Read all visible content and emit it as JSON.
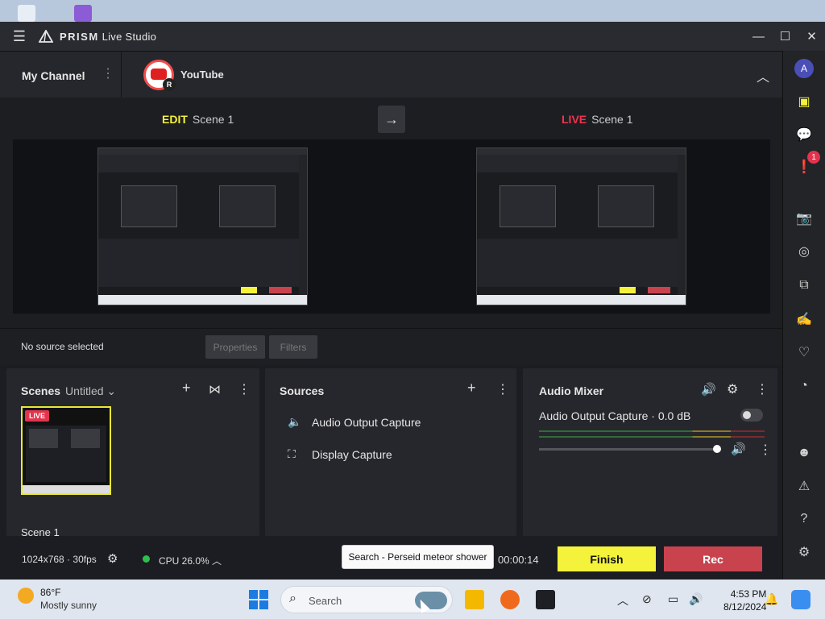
{
  "app": {
    "title_bold": "PRISM",
    "title_rest": "Live Studio",
    "window_buttons": {
      "minimize": "—",
      "maximize": "☐",
      "close": "✕"
    }
  },
  "channel": {
    "my_channel": "My Channel",
    "platform": "YouTube",
    "platform_badge": "R"
  },
  "preview": {
    "edit_keyword": "EDIT",
    "edit_scene": "Scene 1",
    "live_keyword": "LIVE",
    "live_scene": "Scene 1"
  },
  "properties_bar": {
    "status": "No source selected",
    "properties_label": "Properties",
    "filters_label": "Filters"
  },
  "scenes": {
    "title": "Scenes",
    "collection": "Untitled",
    "live_badge": "LIVE",
    "items": [
      {
        "name": "Scene 1"
      }
    ]
  },
  "sources": {
    "title": "Sources",
    "items": [
      {
        "name": "Audio Output Capture",
        "icon": "speaker-icon"
      },
      {
        "name": "Display Capture",
        "icon": "display-capture-icon"
      }
    ]
  },
  "audio_mixer": {
    "title": "Audio Mixer",
    "channels": [
      {
        "name": "Audio Output Capture",
        "level": "0.0 dB",
        "volume_fraction": 1.0
      }
    ]
  },
  "status": {
    "resolution": "1024x768",
    "fps": "30fps",
    "cpu": "CPU 26.0%",
    "timer": "00:00:14",
    "finish_label": "Finish",
    "rec_label": "Rec"
  },
  "tooltip": "Search - Perseid meteor shower",
  "taskbar": {
    "weather_temp": "86°F",
    "weather_desc": "Mostly sunny",
    "search_placeholder": "Search",
    "time": "4:53 PM",
    "date": "8/12/2024"
  },
  "sidebar": {
    "avatar_letter": "A",
    "notification_count": "1"
  },
  "colors": {
    "edit": "#f4f23a",
    "live": "#f2334e",
    "finish": "#f4f23a",
    "rec": "#c8434d",
    "cpu_ok": "#2ec04a"
  }
}
